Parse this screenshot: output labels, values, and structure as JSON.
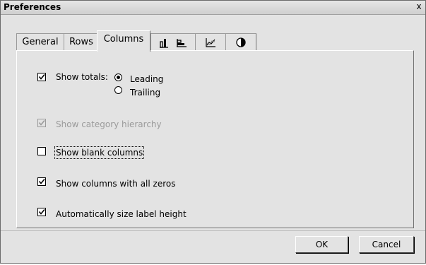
{
  "window": {
    "title": "Preferences",
    "close_label": "x"
  },
  "tabs": [
    {
      "label": "General"
    },
    {
      "label": "Rows"
    },
    {
      "label": "Columns"
    },
    {
      "icon": "bar-chart-vertical-icon"
    },
    {
      "icon": "bar-chart-horizontal-icon"
    },
    {
      "icon": "line-chart-icon"
    },
    {
      "icon": "pie-chart-icon"
    }
  ],
  "active_tab": "Columns",
  "options": {
    "show_totals": {
      "label": "Show totals:",
      "checked": true
    },
    "leading": {
      "label": "Leading",
      "selected": true
    },
    "trailing": {
      "label": "Trailing",
      "selected": false
    },
    "category_hierarchy": {
      "label": "Show category hierarchy",
      "checked": true,
      "disabled": true
    },
    "blank_columns": {
      "label": "Show blank columns",
      "checked": false
    },
    "all_zeros": {
      "label": "Show columns with all zeros",
      "checked": true
    },
    "auto_size": {
      "label": "Automatically size label height",
      "checked": true
    }
  },
  "buttons": {
    "ok": "OK",
    "cancel": "Cancel"
  }
}
